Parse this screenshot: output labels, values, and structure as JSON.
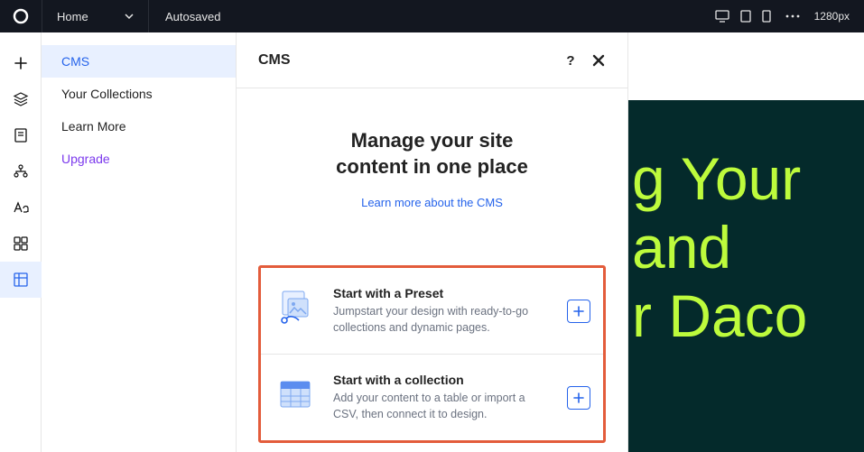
{
  "topbar": {
    "home_label": "Home",
    "autosaved_label": "Autosaved",
    "viewport_px": "1280px"
  },
  "sidebar": {
    "items": [
      {
        "label": "CMS",
        "active": true
      },
      {
        "label": "Your Collections",
        "active": false
      },
      {
        "label": "Learn More",
        "active": false
      },
      {
        "label": "Upgrade",
        "active": false,
        "style": "upgrade"
      }
    ]
  },
  "panel": {
    "header_title": "CMS",
    "heading_line1": "Manage your site",
    "heading_line2": "content in one place",
    "learn_link": "Learn more about the CMS",
    "options": [
      {
        "title": "Start with a Preset",
        "desc": "Jumpstart your design with ready-to-go collections and dynamic pages.",
        "icon": "preset"
      },
      {
        "title": "Start with a collection",
        "desc": "Add your content to a table or import a CSV, then connect it to design.",
        "icon": "collection"
      }
    ]
  },
  "canvas": {
    "hero_line1": "g Your",
    "hero_line2": " and",
    "hero_line3": "r Daco"
  },
  "icons": {
    "leftbar": [
      "add",
      "layers",
      "page",
      "sitemap",
      "type",
      "grid",
      "cms"
    ]
  }
}
